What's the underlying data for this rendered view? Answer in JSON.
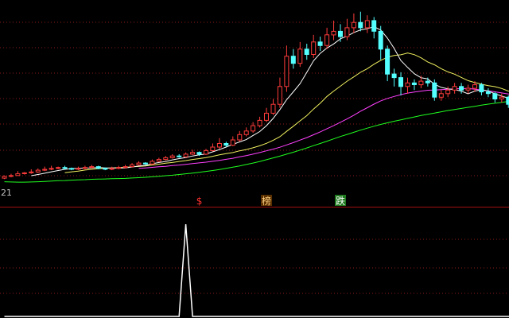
{
  "axis_tick_left": "21",
  "markers": [
    {
      "text": "$",
      "color": "#ff3030",
      "bg": "#000000",
      "index": 29
    },
    {
      "text": "榜",
      "color": "#ffd080",
      "bg": "#5a3000",
      "index": 39
    },
    {
      "text": "跌",
      "color": "#ffffff",
      "bg": "#1f7a1f",
      "index": 50
    }
  ],
  "colors": {
    "background": "#000000",
    "grid": "#8b1a1a",
    "separator": "#a01010",
    "up": "#ff3b3b",
    "down": "#54ffff",
    "ma_short": "#ffffff",
    "ma_mid": "#f0f060",
    "ma_long": "#ff40ff",
    "ma_longest": "#20ff20",
    "indicator": "#ffffff"
  },
  "chart_data": [
    {
      "type": "candlestick",
      "title": "",
      "price_domain": [
        0,
        100
      ],
      "candles": [
        [
          3.5,
          4.5,
          3,
          5
        ],
        [
          4.5,
          5,
          4,
          6
        ],
        [
          5,
          6,
          5,
          7.5
        ],
        [
          6,
          6.5,
          5.5,
          7
        ],
        [
          6.5,
          7,
          6,
          8.5
        ],
        [
          7,
          8,
          6.5,
          9
        ],
        [
          8,
          8.5,
          7.5,
          10
        ],
        [
          8.5,
          9,
          8,
          10.5
        ],
        [
          9,
          9.5,
          8.5,
          10
        ],
        [
          9.5,
          9,
          8.5,
          10.5
        ],
        [
          9,
          8.5,
          8,
          9.5
        ],
        [
          8.5,
          9,
          8,
          10
        ],
        [
          9,
          9.5,
          8.5,
          10.5
        ],
        [
          9.5,
          10,
          9,
          11
        ],
        [
          10,
          9,
          8.5,
          10.5
        ],
        [
          9,
          8.5,
          8,
          9.5
        ],
        [
          8.5,
          9,
          8,
          10
        ],
        [
          9,
          9.5,
          8.5,
          10.5
        ],
        [
          9.5,
          10,
          9,
          11
        ],
        [
          10,
          11,
          9.5,
          12
        ],
        [
          11,
          12,
          10.5,
          13
        ],
        [
          12,
          11.5,
          11,
          12.5
        ],
        [
          11.5,
          13,
          11,
          14
        ],
        [
          13,
          14,
          12.5,
          15
        ],
        [
          14,
          15,
          13.5,
          16
        ],
        [
          15,
          16,
          14.5,
          17
        ],
        [
          16,
          15.5,
          15,
          17
        ],
        [
          15.5,
          17,
          15,
          18
        ],
        [
          17,
          18,
          16.5,
          19.5
        ],
        [
          18,
          17,
          16,
          18.5
        ],
        [
          17,
          19,
          16.5,
          20
        ],
        [
          19,
          21,
          18.5,
          23
        ],
        [
          21,
          23,
          20,
          26
        ],
        [
          23,
          22,
          21,
          24
        ],
        [
          22,
          25,
          21.5,
          27
        ],
        [
          25,
          28,
          24,
          30
        ],
        [
          28,
          30,
          27,
          32
        ],
        [
          30,
          33,
          29,
          35
        ],
        [
          33,
          36,
          32,
          38
        ],
        [
          36,
          40,
          35,
          43
        ],
        [
          40,
          45,
          39,
          48
        ],
        [
          45,
          55,
          43,
          60
        ],
        [
          55,
          72,
          52,
          78
        ],
        [
          72,
          68,
          65,
          76
        ],
        [
          68,
          76,
          66,
          80
        ],
        [
          76,
          73,
          70,
          79
        ],
        [
          73,
          80,
          71,
          84
        ],
        [
          80,
          78,
          75,
          83
        ],
        [
          78,
          84,
          76,
          88
        ],
        [
          84,
          86,
          81,
          92
        ],
        [
          86,
          83,
          80,
          90
        ],
        [
          83,
          88,
          81,
          93
        ],
        [
          88,
          91,
          85,
          96
        ],
        [
          91,
          88,
          86,
          97
        ],
        [
          88,
          92,
          85,
          95
        ],
        [
          92,
          86,
          82,
          94
        ],
        [
          86,
          76,
          70,
          89
        ],
        [
          76,
          62,
          58,
          78
        ],
        [
          62,
          60,
          55,
          65
        ],
        [
          60,
          55,
          50,
          63
        ],
        [
          55,
          57,
          51,
          60
        ],
        [
          57,
          56,
          53,
          59
        ],
        [
          56,
          58,
          54,
          61
        ],
        [
          58,
          57,
          55,
          60
        ],
        [
          57,
          49,
          47,
          59
        ],
        [
          49,
          51,
          47,
          53
        ],
        [
          51,
          53,
          49,
          55
        ],
        [
          53,
          55,
          51,
          57
        ],
        [
          55,
          53,
          51,
          57
        ],
        [
          53,
          54,
          51,
          56
        ],
        [
          54,
          56,
          52,
          58
        ],
        [
          56,
          52,
          50,
          57
        ],
        [
          52,
          51,
          49,
          54
        ],
        [
          51,
          48,
          46,
          52
        ],
        [
          48,
          49,
          46,
          51
        ],
        [
          49,
          45,
          43,
          50
        ],
        [
          45,
          44,
          42,
          47
        ]
      ],
      "ma_short": [
        null,
        null,
        null,
        null,
        4.9,
        5.6,
        6.3,
        7.1,
        7.8,
        8.5,
        8.9,
        9.1,
        9.2,
        9.3,
        9.5,
        9.3,
        9.3,
        9.2,
        9.3,
        9.8,
        10.3,
        10.7,
        11.6,
        12.3,
        12.9,
        13.8,
        14.5,
        15.1,
        16,
        16.6,
        17.1,
        18.3,
        19.6,
        21,
        22.5,
        23.9,
        25.2,
        27.5,
        29.7,
        33,
        37.1,
        42,
        47.6,
        52,
        56.6,
        62.9,
        69.4,
        73.6,
        76.6,
        78.9,
        81.8,
        83.3,
        85.3,
        86.8,
        87.4,
        88.6,
        86.7,
        82.2,
        76.4,
        69.6,
        65.7,
        62.2,
        59.9,
        59.3,
        56.3,
        54.5,
        53.7,
        53.2,
        52.4,
        50.9,
        52.4,
        53.2,
        52.5,
        50.9,
        49.6,
        48.5,
        47.1
      ],
      "ma_mid": [
        null,
        null,
        null,
        null,
        null,
        null,
        null,
        null,
        null,
        6.6,
        7.1,
        7.5,
        8.1,
        8.5,
        8.9,
        9,
        9.3,
        9.5,
        9.6,
        9.9,
        10.1,
        10.4,
        10.9,
        11.4,
        11.9,
        12.3,
        12.9,
        13.4,
        14,
        14.5,
        15.1,
        15.8,
        16.6,
        17.3,
        17.9,
        18.9,
        19.6,
        20.6,
        21.7,
        23.1,
        24.8,
        26.8,
        29.8,
        32.7,
        35.7,
        38.6,
        42.3,
        45.6,
        49.4,
        52.4,
        55.2,
        58,
        60.4,
        63,
        65,
        67.5,
        69.7,
        71.4,
        72.4,
        72.8,
        73.8,
        72.9,
        71.1,
        68.8,
        67.2,
        65,
        63.2,
        61.9,
        60.1,
        58.3,
        57.2,
        56.3,
        55.5,
        54.9,
        53.9,
        52.4,
        51.7
      ],
      "ma_long": [
        null,
        null,
        null,
        null,
        null,
        null,
        null,
        null,
        null,
        null,
        null,
        null,
        null,
        null,
        null,
        null,
        null,
        null,
        null,
        null,
        9,
        9.3,
        9.6,
        9.9,
        10.2,
        10.6,
        10.9,
        11.3,
        11.7,
        12.1,
        12.5,
        13,
        13.5,
        14.1,
        14.7,
        15.5,
        16.2,
        17,
        17.9,
        18.9,
        19.8,
        20.9,
        22.2,
        23.5,
        24.9,
        26.3,
        27.9,
        29.5,
        31.3,
        33,
        34.9,
        36.8,
        38.9,
        41.1,
        43.1,
        45.1,
        46.9,
        48.3,
        49.4,
        50.4,
        51.3,
        51.9,
        52.4,
        52.9,
        53,
        53.2,
        53.5,
        53.7,
        53.8,
        53.9,
        53.5,
        53.1,
        52.6,
        52,
        51.4,
        50.8,
        50.2
      ],
      "ma_longest": [
        1.5,
        1.4,
        1.3,
        1.3,
        1.4,
        1.5,
        1.7,
        1.9,
        2.1,
        2.2,
        2.4,
        2.6,
        2.7,
        2.9,
        3,
        3.1,
        3.2,
        3.3,
        3.4,
        3.6,
        3.8,
        4,
        4.3,
        4.6,
        4.9,
        5.2,
        5.6,
        6,
        6.4,
        6.8,
        7.3,
        7.8,
        8.4,
        9,
        9.7,
        10.4,
        11.2,
        12,
        12.9,
        13.9,
        14.9,
        15.9,
        17,
        18.1,
        19.3,
        20.5,
        21.8,
        23,
        24.3,
        25.6,
        26.9,
        28.1,
        29.3,
        30.5,
        31.6,
        32.7,
        33.7,
        34.6,
        35.5,
        36.3,
        37.1,
        37.9,
        38.7,
        39.4,
        40.1,
        40.8,
        41.5,
        42.1,
        42.7,
        43.3,
        43.9,
        44.5,
        45.1,
        45.6,
        46.1,
        46.6,
        47.1
      ]
    },
    {
      "type": "line",
      "title": "",
      "y_domain": [
        0,
        1
      ],
      "x": [
        0,
        26,
        27,
        28,
        76
      ],
      "values": [
        0,
        0,
        1,
        0,
        0
      ]
    }
  ]
}
